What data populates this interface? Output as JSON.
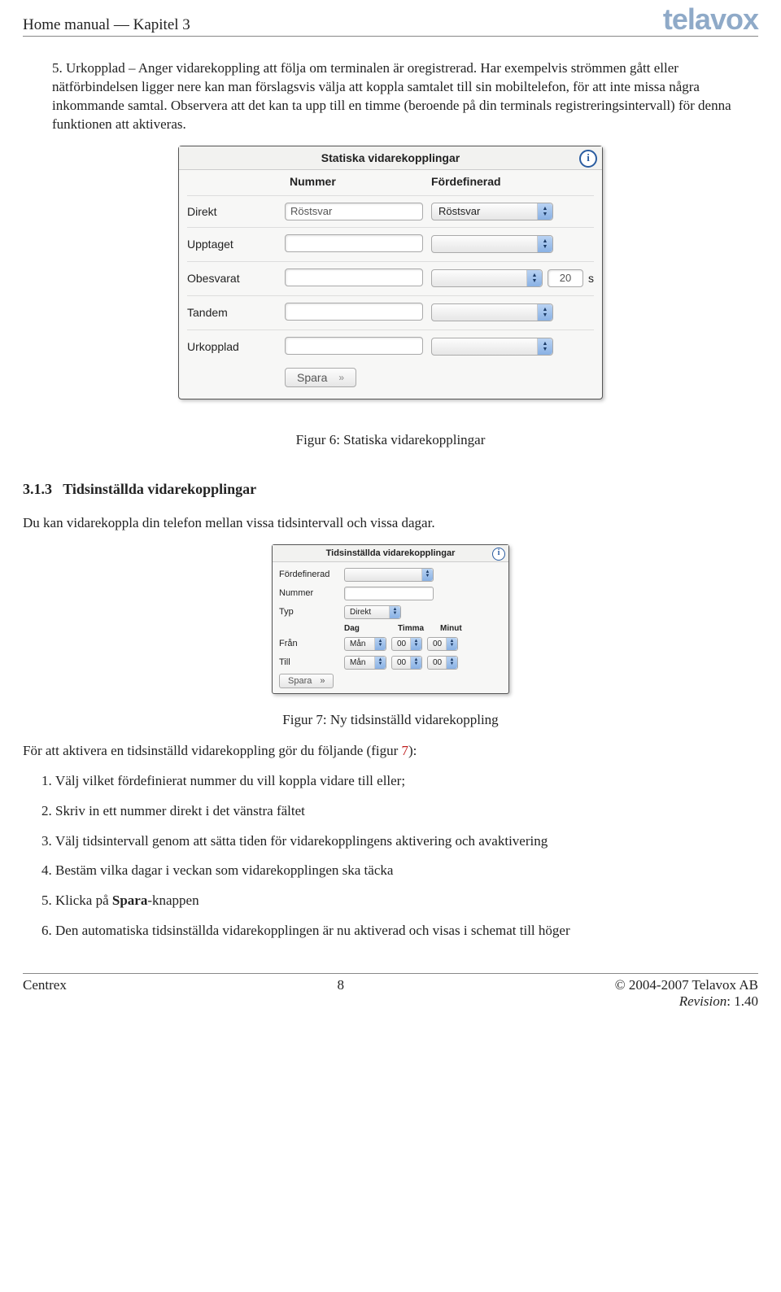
{
  "header": {
    "title": "Home manual — Kapitel 3",
    "brand": "telavox"
  },
  "intro_item": "Urkopplad – Anger vidarekoppling att följa om terminalen är oregistrerad. Har exempelvis strömmen gått eller nätförbindelsen ligger nere kan man förslagsvis välja att koppla samtalet till sin mobiltelefon, för att inte missa några inkommande samtal. Observera att det kan ta upp till en timme (beroende på din terminals registreringsintervall) för denna funktionen att aktiveras.",
  "fig6": {
    "title": "Statiska vidarekopplingar",
    "col_nummer": "Nummer",
    "col_fordefinerad": "Fördefinerad",
    "rows": {
      "direkt": {
        "label": "Direkt",
        "nummer": "Röstsvar",
        "fordefinerad": "Röstsvar"
      },
      "upptaget": {
        "label": "Upptaget",
        "nummer": "",
        "fordefinerad": ""
      },
      "obesvarat": {
        "label": "Obesvarat",
        "nummer": "",
        "seconds": "20",
        "s": "s"
      },
      "tandem": {
        "label": "Tandem",
        "nummer": "",
        "fordefinerad": ""
      },
      "urkopplad": {
        "label": "Urkopplad",
        "nummer": "",
        "fordefinerad": ""
      }
    },
    "save": "Spara",
    "caption": "Figur 6: Statiska vidarekopplingar"
  },
  "section": {
    "num": "3.1.3",
    "title": "Tidsinställda vidarekopplingar",
    "intro": "Du kan vidarekoppla din telefon mellan vissa tidsintervall och vissa dagar."
  },
  "fig7": {
    "title": "Tidsinställda vidarekopplingar",
    "labels": {
      "fordefinerad": "Fördefinerad",
      "nummer": "Nummer",
      "typ": "Typ",
      "typ_val": "Direkt",
      "dag": "Dag",
      "timma": "Timma",
      "minut": "Minut",
      "fran": "Från",
      "till": "Till",
      "day_val": "Mån",
      "hour_val": "00",
      "min_val": "00"
    },
    "save": "Spara",
    "caption": "Figur 7: Ny tidsinställd vidarekoppling"
  },
  "text_before_steps_a": "För att aktivera en tidsinställd vidarekoppling gör du följande (figur ",
  "text_before_steps_link": "7",
  "text_before_steps_b": "):",
  "steps": [
    "Välj vilket fördefinierat nummer du vill koppla vidare till eller;",
    "Skriv in ett nummer direkt i det vänstra fältet",
    "Välj tidsintervall genom att sätta tiden för vidarekopplingens aktivering och avaktivering",
    "Bestäm vilka dagar i veckan som vidarekopplingen ska täcka",
    "Klicka på Spara-knappen",
    "Den automatiska tidsinställda vidarekopplingen är nu aktiverad och visas i schemat till höger"
  ],
  "footer": {
    "left": "Centrex",
    "page": "8",
    "copyright": "© 2004-2007 Telavox AB",
    "revision_label": "Revision",
    "revision_val": ": 1.40"
  }
}
